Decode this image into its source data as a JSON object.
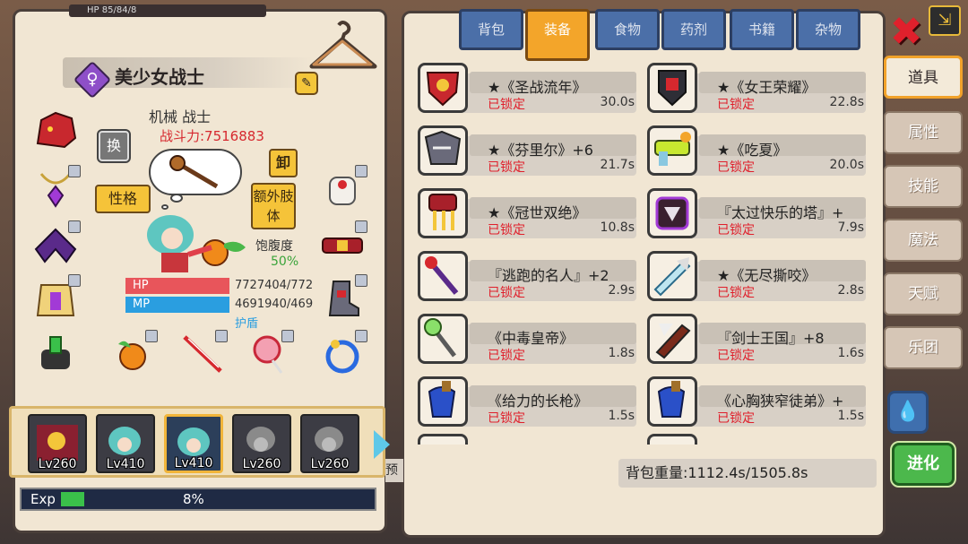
{
  "top_strip": {
    "label": "HP",
    "value": "85/84/8"
  },
  "character": {
    "name": "美少女战士",
    "gender_symbol": "♀",
    "class": "机械 战士",
    "power": "战斗力:7516883",
    "swap_label": "换",
    "unequip_label": "卸",
    "personality_label": "性格",
    "extra_limb_label": "额外肢体",
    "satiety_label": "饱腹度",
    "satiety_value": "50%",
    "hp_label": "HP",
    "hp_value": "7727404/772",
    "hp_fraction": 1.0,
    "mp_label": "MP",
    "mp_value": "4691940/469",
    "mp_fraction": 1.0,
    "shield_label": "护盾"
  },
  "party": [
    {
      "level": "Lv260",
      "active": false
    },
    {
      "level": "Lv410",
      "active": false
    },
    {
      "level": "Lv410",
      "active": true
    },
    {
      "level": "Lv260",
      "active": false
    },
    {
      "level": "Lv260",
      "active": false
    }
  ],
  "exp": {
    "label": "Exp",
    "percent": "8%"
  },
  "bag": {
    "tabs": [
      {
        "label": "背包",
        "active": false
      },
      {
        "label": "装备",
        "active": true
      },
      {
        "label": "食物",
        "active": false
      },
      {
        "label": "药剂",
        "active": false
      },
      {
        "label": "书籍",
        "active": false
      },
      {
        "label": "杂物",
        "active": false
      }
    ],
    "items": [
      {
        "name": "★《圣战流年》",
        "lock": "已锁定",
        "weight": "30.0s"
      },
      {
        "name": "★《女王荣耀》",
        "lock": "已锁定",
        "weight": "22.8s"
      },
      {
        "name": "★《芬里尔》+6",
        "lock": "已锁定",
        "weight": "21.7s"
      },
      {
        "name": "★《吃夏》",
        "lock": "已锁定",
        "weight": "20.0s"
      },
      {
        "name": "★《冠世双绝》",
        "lock": "已锁定",
        "weight": "10.8s"
      },
      {
        "name": "『太过快乐的塔』+",
        "lock": "已锁定",
        "weight": "7.9s"
      },
      {
        "name": "『逃跑的名人』+2",
        "lock": "已锁定",
        "weight": "2.9s"
      },
      {
        "name": "★《无尽撕咬》",
        "lock": "已锁定",
        "weight": "2.8s"
      },
      {
        "name": "《中毒皇帝》",
        "lock": "已锁定",
        "weight": "1.8s"
      },
      {
        "name": "『剑士王国』+8",
        "lock": "已锁定",
        "weight": "1.6s"
      },
      {
        "name": "《给力的长枪》",
        "lock": "已锁定",
        "weight": "1.5s"
      },
      {
        "name": "《心胸狭窄徒弟》+",
        "lock": "已锁定",
        "weight": "1.5s"
      }
    ],
    "weight_summary": "背包重量:1112.4s/1505.8s"
  },
  "side_menu": [
    {
      "label": "道具",
      "active": true
    },
    {
      "label": "属性",
      "active": false
    },
    {
      "label": "技能",
      "active": false
    },
    {
      "label": "魔法",
      "active": false
    },
    {
      "label": "天赋",
      "active": false
    },
    {
      "label": "乐团",
      "active": false
    }
  ],
  "evolve_label": "进化",
  "hint_text": "预",
  "colors": {
    "lock_red": "#e01f2b",
    "power_red": "#d6282e",
    "satiety_green": "#3aa43a",
    "hp_bar": "#e8555b",
    "mp_bar": "#2a9ee0",
    "tab_blue": "#4b6fa8",
    "tab_active": "#f3a52a",
    "panel_bg": "#f1e6d3"
  },
  "icons": {
    "close": "close-x-icon",
    "corner": "exit-icon",
    "drop": "water-drop-icon",
    "hanger": "hanger-icon",
    "edit": "edit-pencil-icon"
  }
}
